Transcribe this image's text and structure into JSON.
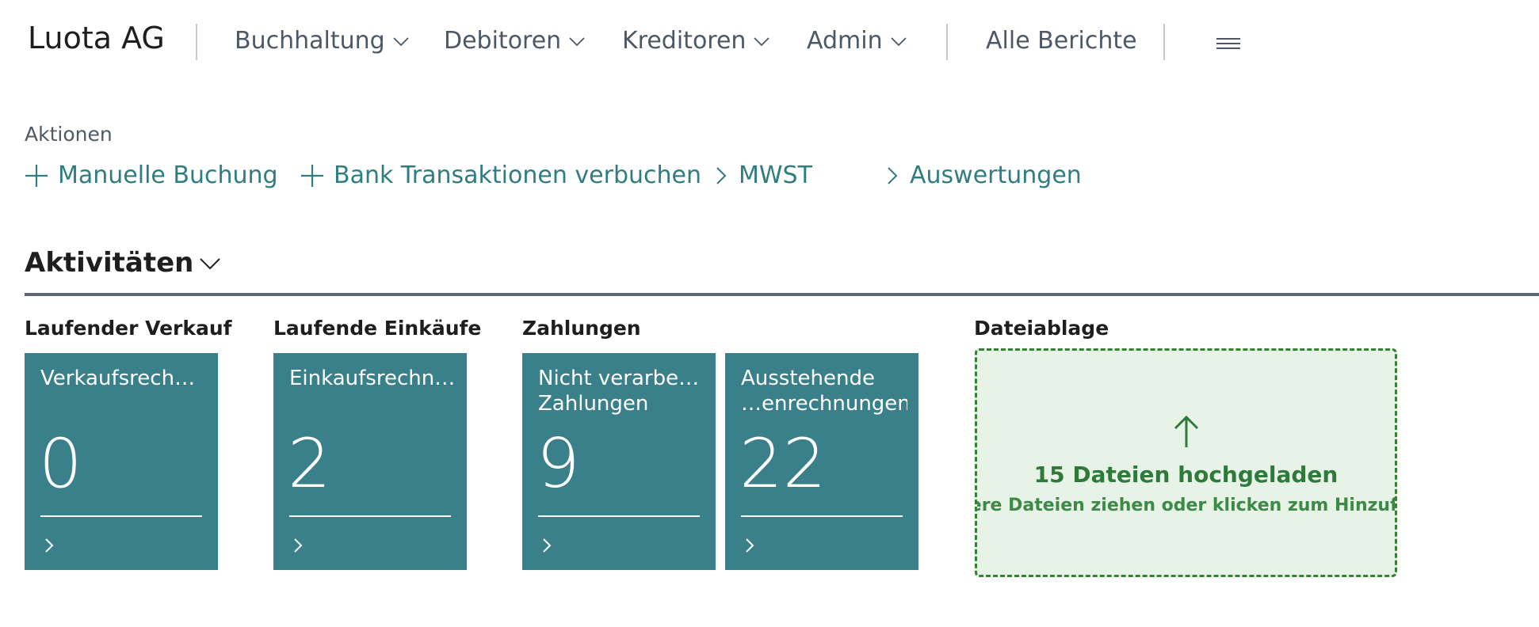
{
  "header": {
    "company": "Luota AG",
    "menus": [
      {
        "label": "Buchhaltung"
      },
      {
        "label": "Debitoren"
      },
      {
        "label": "Kreditoren"
      },
      {
        "label": "Admin"
      }
    ],
    "all_reports": "Alle Berichte",
    "hamburger_icon": "hamburger-menu-icon"
  },
  "actions": {
    "section_label": "Aktionen",
    "items": [
      {
        "label": "Manuelle Buchung",
        "icon": "plus-icon"
      },
      {
        "label": "Bank Transaktionen verbuchen",
        "icon": "plus-icon"
      },
      {
        "label": "MWST",
        "icon": "chevron-right-icon"
      },
      {
        "label": "Auswertungen",
        "icon": "chevron-right-icon"
      }
    ]
  },
  "activities": {
    "heading": "Aktivitäten",
    "groups": [
      {
        "title": "Laufender Verkauf"
      },
      {
        "title": "Laufende Einkäufe"
      },
      {
        "title": "Zahlungen"
      },
      {
        "title": "Dateiablage"
      }
    ],
    "tiles": [
      {
        "label": "Verkaufsrechnungen",
        "label2": "",
        "value": "0"
      },
      {
        "label": "Einkaufsrechnungen",
        "label2": "",
        "value": "2"
      },
      {
        "label": "Nicht verarbeitete",
        "label2": "Zahlungen",
        "value": "9"
      },
      {
        "label": "Ausstehende",
        "label2": "…enrechnungen",
        "value": "22"
      }
    ],
    "dropzone": {
      "title": "15 Dateien hochgeladen",
      "subtitle": "Weitere Dateien ziehen oder klicken zum Hinzufügen"
    }
  },
  "colors": {
    "tile_bg": "#3a808a",
    "accent_link": "#2f7d7f",
    "dropzone_border": "#358235",
    "dropzone_bg": "#e8f3e8"
  }
}
